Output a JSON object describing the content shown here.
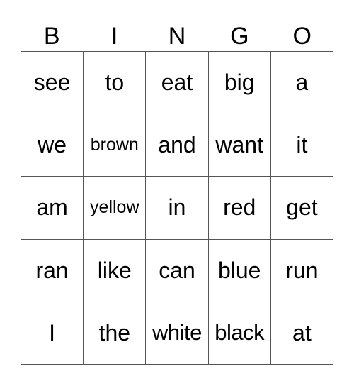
{
  "header": [
    "B",
    "I",
    "N",
    "G",
    "O"
  ],
  "cells": [
    [
      "see",
      "to",
      "eat",
      "big",
      "a"
    ],
    [
      "we",
      "brown",
      "and",
      "want",
      "it"
    ],
    [
      "am",
      "yellow",
      "in",
      "red",
      "get"
    ],
    [
      "ran",
      "like",
      "can",
      "blue",
      "run"
    ],
    [
      "I",
      "the",
      "white",
      "black",
      "at"
    ]
  ]
}
